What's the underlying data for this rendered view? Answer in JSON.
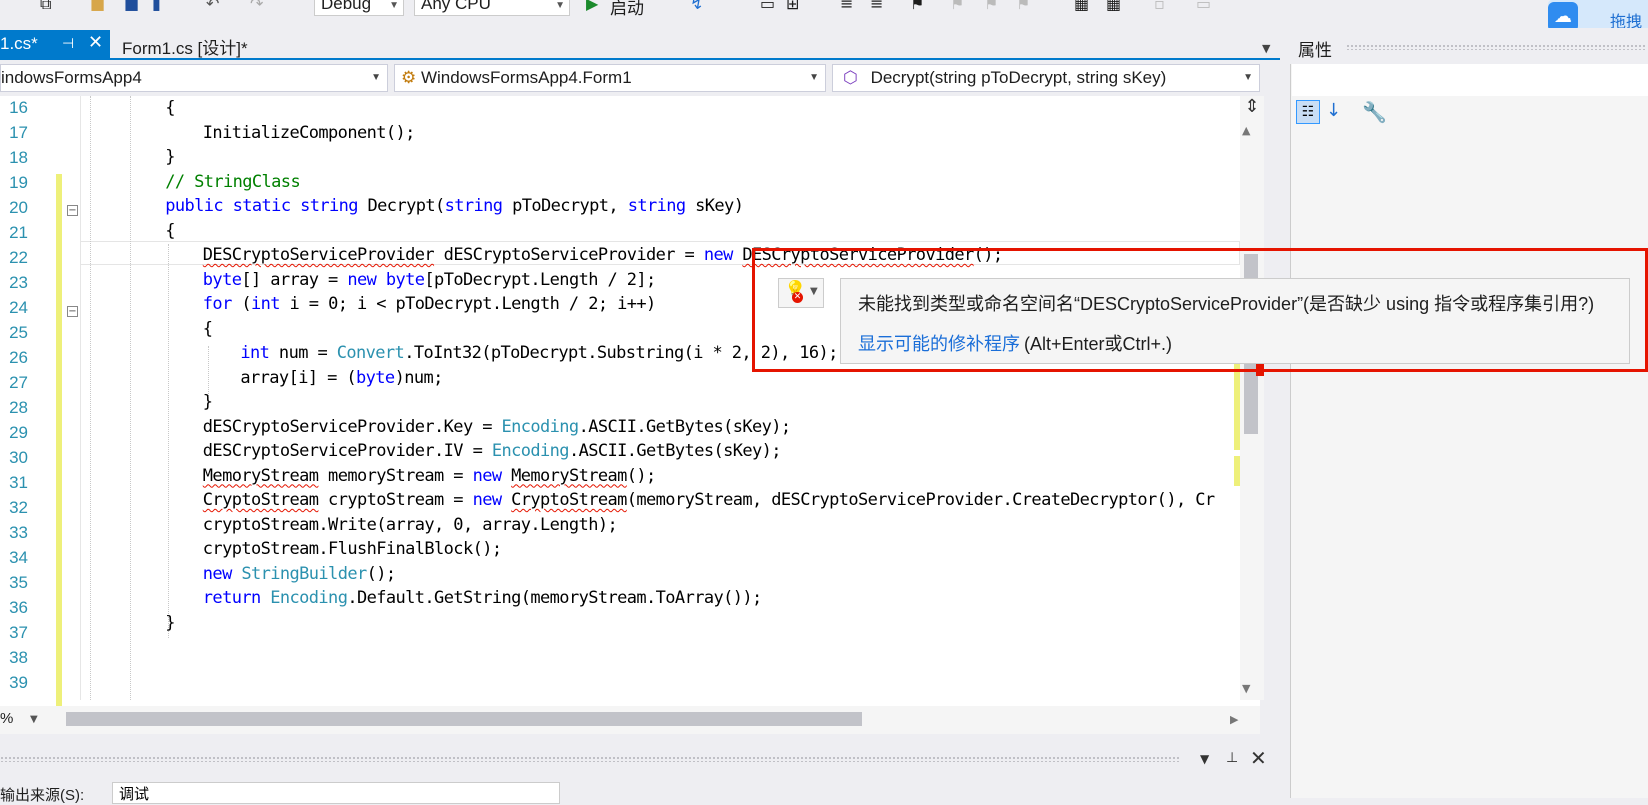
{
  "toolbar": {
    "config": "Debug",
    "platform": "Any CPU",
    "start_label": "启动"
  },
  "cloud_button": "拖拽",
  "tabs": {
    "active_label": "1.cs*",
    "inactive_label": "Form1.cs [设计]*"
  },
  "nav": {
    "project": "indowsFormsApp4",
    "class": "WindowsFormsApp4.Form1",
    "member": "Decrypt(string pToDecrypt, string sKey)"
  },
  "editor": {
    "line_numbers": [
      "16",
      "17",
      "18",
      "19",
      "20",
      "21",
      "22",
      "23",
      "24",
      "25",
      "26",
      "27",
      "28",
      "29",
      "30",
      "31",
      "32",
      "33",
      "34",
      "35",
      "36",
      "37",
      "38",
      "39"
    ]
  },
  "zoom": "%",
  "error_popup": {
    "message": "未能找到类型或命名空间名“DESCryptoServiceProvider”(是否缺少 using 指令或程序集引用?)",
    "fix_link": "显示可能的修补程序",
    "fix_keys": "(Alt+Enter或Ctrl+.)"
  },
  "output": {
    "label": "输出来源(S):",
    "source": "调试"
  },
  "properties": {
    "title": "属性"
  },
  "colors": {
    "accent": "#007acc",
    "error": "#e51400",
    "keyword": "#0000ff",
    "type": "#2b91af",
    "comment": "#008000"
  }
}
